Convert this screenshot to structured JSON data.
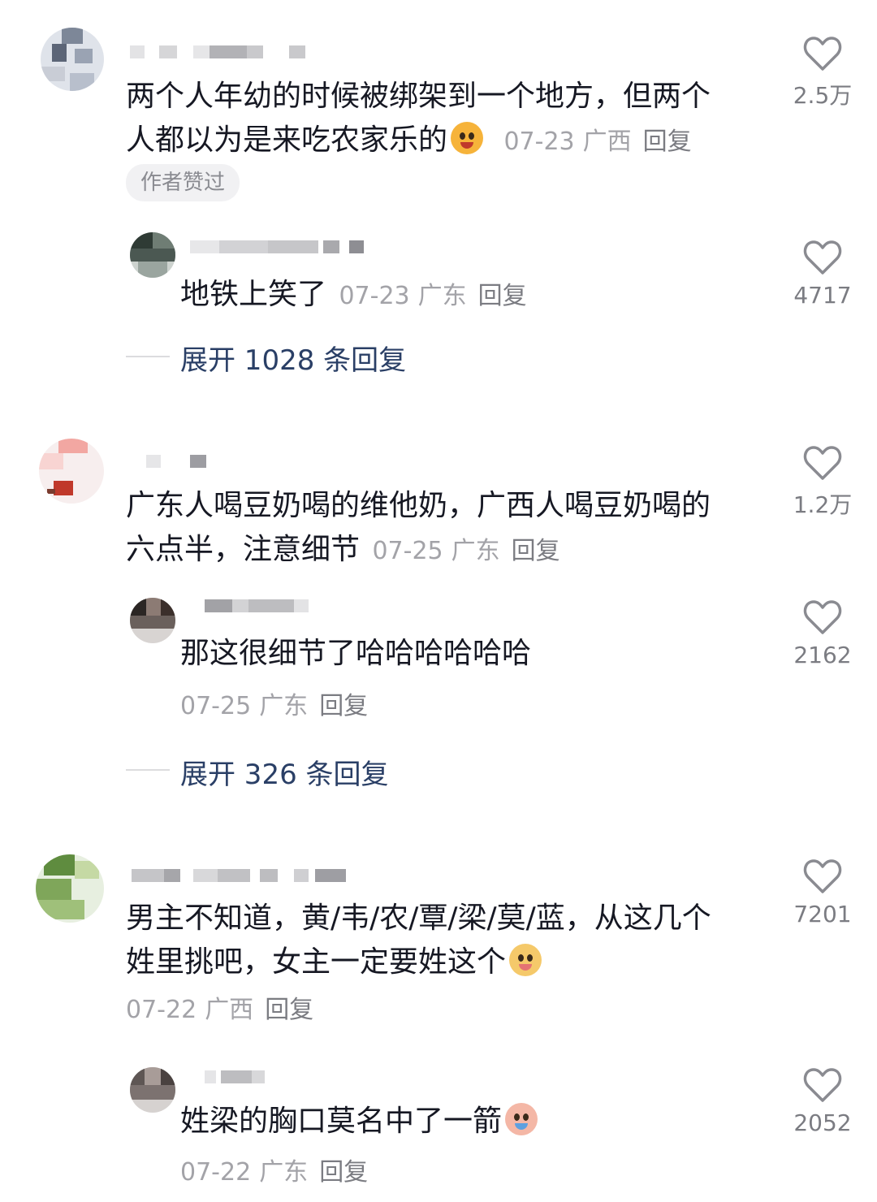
{
  "comments": [
    {
      "text_line1": "两个人年幼的时候被绑架到一个地方，但两个",
      "text_line2": "人都以为是来吃农家乐的",
      "date": "07-23",
      "location": "广西",
      "reply_label": "回复",
      "likes": "2.5万",
      "badge": "作者赞过",
      "emoji": "smiling-orange-face",
      "reply": {
        "text": "地铁上笑了",
        "date": "07-23",
        "location": "广东",
        "reply_label": "回复",
        "likes": "4717"
      },
      "expand_label": "展开 1028 条回复"
    },
    {
      "text_line1": "广东人喝豆奶喝的维他奶，广西人喝豆奶喝的",
      "text_line2": "六点半，注意细节",
      "date": "07-25",
      "location": "广东",
      "reply_label": "回复",
      "likes": "1.2万",
      "reply": {
        "text": "那这很细节了哈哈哈哈哈哈",
        "date": "07-25",
        "location": "广东",
        "reply_label": "回复",
        "likes": "2162"
      },
      "expand_label": "展开 326 条回复"
    },
    {
      "text_line1": "男主不知道，黄/韦/农/覃/梁/莫/蓝，从这几个",
      "text_line2": "姓里挑吧，女主一定要姓这个",
      "date": "07-22",
      "location": "广西",
      "reply_label": "回复",
      "likes": "7201",
      "emoji": "yellow-dog-face",
      "reply": {
        "text": "姓梁的胸口莫名中了一箭",
        "date": "07-22",
        "location": "广东",
        "reply_label": "回复",
        "likes": "2052",
        "emoji": "crying-face"
      }
    }
  ],
  "colors": {
    "text": "#161823",
    "meta": "#a3a3a8",
    "expand": "#2a3f66",
    "heart_outline": "#8a8b91"
  }
}
